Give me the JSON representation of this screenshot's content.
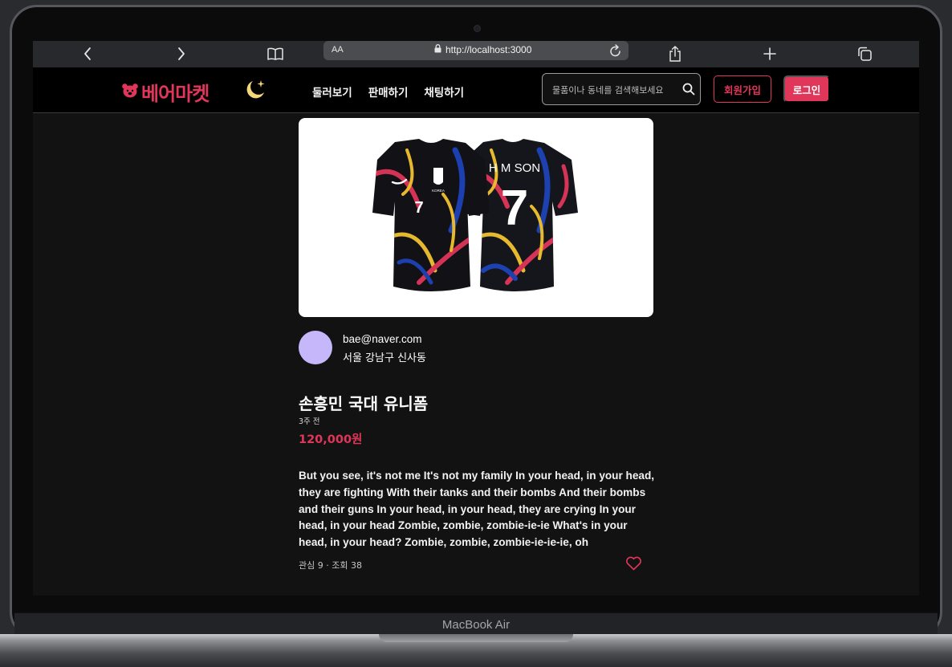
{
  "device": {
    "label": "MacBook Air"
  },
  "browser": {
    "text_size_button": "AA",
    "url": "http://localhost:3000",
    "icons": [
      "back-icon",
      "forward-icon",
      "bookmarks-icon",
      "lock-icon",
      "reload-icon",
      "share-icon",
      "new-tab-icon",
      "tabs-icon"
    ]
  },
  "header": {
    "logo_text": "베어마켓",
    "nav": [
      "둘러보기",
      "판매하기",
      "채팅하기"
    ],
    "search_placeholder": "물품이나 동네를 검색해보세요",
    "signup_label": "회원가입",
    "login_label": "로그인"
  },
  "product": {
    "image": {
      "jersey_name": "H M SON",
      "jersey_number": "7",
      "country": "KOREA"
    },
    "seller": {
      "email": "bae@naver.com",
      "region": "서울 강남구 신사동"
    },
    "title": "손흥민 국대 유니폼",
    "time_ago": "3주 전",
    "price": "120,000원",
    "description": "But you see, it's not me It's not my family In your head, in your head, they are fighting With their tanks and their bombs And their bombs and their guns In your head, in your head, they are crying In your head, in your head Zombie, zombie, zombie-ie-ie What's in your head, in your head? Zombie, zombie, zombie-ie-ie-ie, oh",
    "stats": "관심 9 · 조회 38"
  },
  "colors": {
    "accent": "#e0365a",
    "avatar": "#c6b7fb",
    "moon": "#f4d77a",
    "background": "#121212"
  }
}
